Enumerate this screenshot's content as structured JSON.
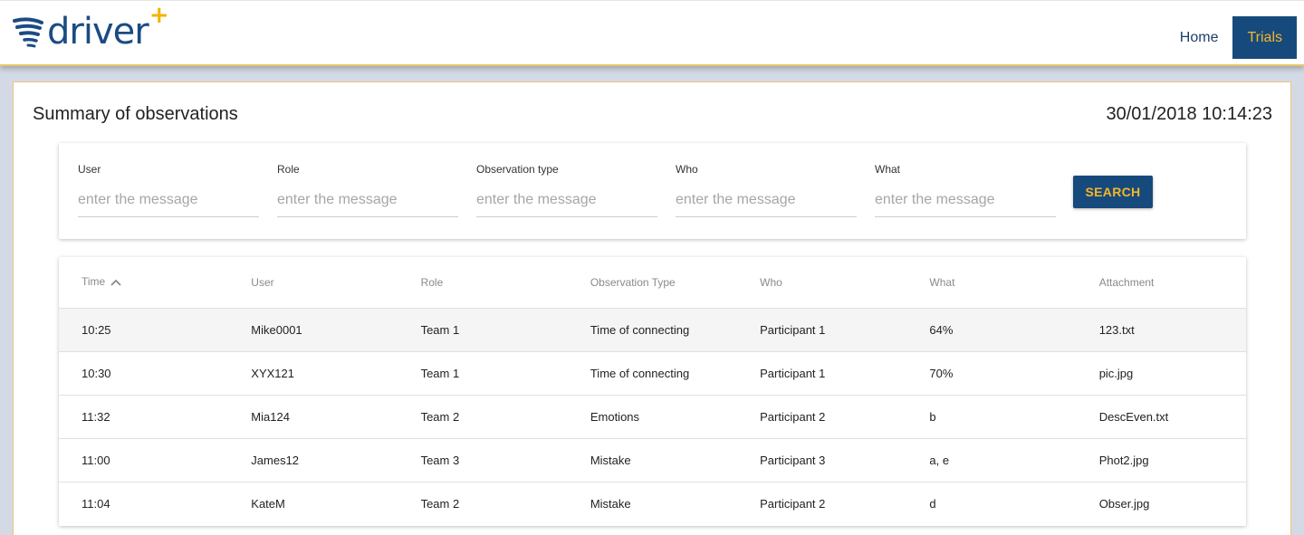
{
  "header": {
    "logo_text": "driver",
    "logo_plus": "+",
    "nav": [
      {
        "label": "Home",
        "active": false
      },
      {
        "label": "Trials",
        "active": true
      }
    ]
  },
  "page": {
    "title": "Summary of observations",
    "timestamp": "30/01/2018 10:14:23"
  },
  "filters": {
    "fields": [
      {
        "label": "User",
        "placeholder": "enter the message"
      },
      {
        "label": "Role",
        "placeholder": "enter the message"
      },
      {
        "label": "Observation type",
        "placeholder": "enter the message"
      },
      {
        "label": "Who",
        "placeholder": "enter the message"
      },
      {
        "label": "What",
        "placeholder": "enter the message"
      }
    ],
    "search_label": "SEARCH"
  },
  "table": {
    "columns": [
      "Time",
      "User",
      "Role",
      "Observation Type",
      "Who",
      "What",
      "Attachment"
    ],
    "sort_icon": "chevron-up-icon",
    "rows": [
      [
        "10:25",
        "Mike0001",
        "Team 1",
        "Time of connecting",
        "Participant 1",
        "64%",
        "123.txt"
      ],
      [
        "10:30",
        "XYX121",
        "Team 1",
        "Time of connecting",
        "Participant 1",
        "70%",
        "pic.jpg"
      ],
      [
        "11:32",
        "Mia124",
        "Team 2",
        "Emotions",
        "Participant 2",
        "b",
        "DescEven.txt"
      ],
      [
        "11:00",
        "James12",
        "Team 3",
        "Mistake",
        "Participant 3",
        "a, e",
        "Phot2.jpg"
      ],
      [
        "11:04",
        "KateM",
        "Team 2",
        "Mistake",
        "Participant 2",
        "d",
        "Obser.jpg"
      ]
    ]
  },
  "colors": {
    "brand_navy": "#174a7c",
    "brand_gold": "#f5b629",
    "background": "#d3dae6"
  }
}
